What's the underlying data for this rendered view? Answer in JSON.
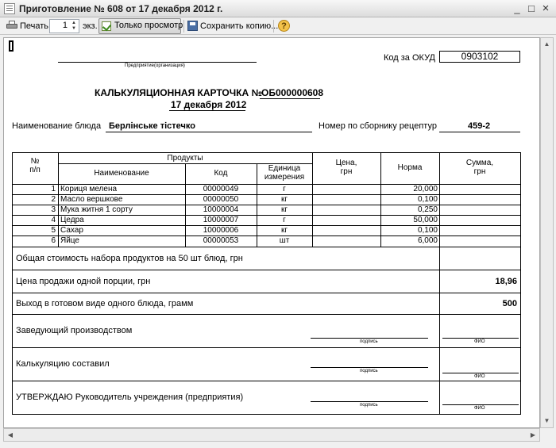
{
  "window": {
    "title": "Приготовление № 608 от 17 декабря 2012 г.",
    "minimize": "_",
    "maximize": "□",
    "close": "×"
  },
  "toolbar": {
    "print_label": "Печать",
    "copies_value": "1",
    "copies_unit": "экз.",
    "view_only_label": "Только просмотр",
    "save_copy_label": "Сохранить копию...",
    "help_label": "?"
  },
  "doc": {
    "enterprise_caption": "Предприятие(организация)",
    "okud_label": "Код за ОКУД",
    "okud_value": "0903102",
    "title_prefix": "КАЛЬКУЛЯЦИОННАЯ КАРТОЧКА №",
    "card_number": "ОБ000000608",
    "date": "17 декабря 2012",
    "dish_label": "Наименование блюда",
    "dish_name": "Берлінське тістечко",
    "recipe_label": "Номер по сборнику рецептур",
    "recipe_value": "459-2",
    "headers": {
      "num": "№\nп/п",
      "products": "Продукты",
      "name": "Наименование",
      "code": "Код",
      "unit": "Единица\nизмерения",
      "price": "Цена,\nгрн",
      "norm": "Норма",
      "sum": "Сумма,\nгрн"
    },
    "rows": [
      {
        "n": "1",
        "name": "Кориця мелена",
        "code": "00000049",
        "unit": "г",
        "price": "",
        "norm": "20,000",
        "sum": ""
      },
      {
        "n": "2",
        "name": "Масло вершкове",
        "code": "00000050",
        "unit": "кг",
        "price": "",
        "norm": "0,100",
        "sum": ""
      },
      {
        "n": "3",
        "name": "Мука житня 1 сорту",
        "code": "10000004",
        "unit": "кг",
        "price": "",
        "norm": "0,250",
        "sum": ""
      },
      {
        "n": "4",
        "name": "Цедра",
        "code": "10000007",
        "unit": "г",
        "price": "",
        "norm": "50,000",
        "sum": ""
      },
      {
        "n": "5",
        "name": "Сахар",
        "code": "10000006",
        "unit": "кг",
        "price": "",
        "norm": "0,100",
        "sum": ""
      },
      {
        "n": "6",
        "name": "Яйце",
        "code": "00000053",
        "unit": "шт",
        "price": "",
        "norm": "6,000",
        "sum": ""
      }
    ],
    "total_cost_label": "Общая стоимость набора продуктов на 50 шт блюд, грн",
    "total_cost_value": "",
    "price_label": "Цена продажи одной порции, грн",
    "price_value": "18,96",
    "yield_label": "Выход в готовом виде одного блюда, грамм",
    "yield_value": "500",
    "sig1_label": "Заведующий производством",
    "sig2_label": "Калькуляцию составил",
    "sig3_label": "УТВЕРЖДАЮ Руководитель учреждения (предприятия)",
    "sign_caption": "подпись",
    "fio_caption": "ФИО"
  }
}
